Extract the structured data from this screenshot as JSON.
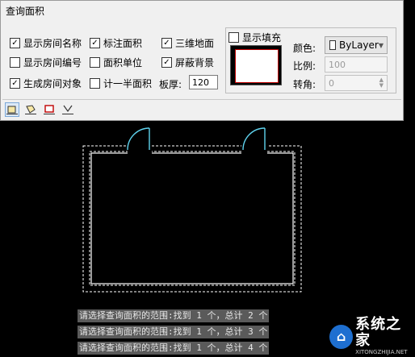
{
  "dialog": {
    "title": "查询面积",
    "options": [
      {
        "label": "显示房间名称",
        "checked": true
      },
      {
        "label": "标注面积",
        "checked": true
      },
      {
        "label": "三维地面",
        "checked": true
      },
      {
        "label": "显示房间编号",
        "checked": false
      },
      {
        "label": "面积单位",
        "checked": false
      },
      {
        "label": "屏蔽背景",
        "checked": true
      },
      {
        "label": "生成房间对象",
        "checked": true
      },
      {
        "label": "计一半面积",
        "checked": false
      }
    ],
    "thickness_label": "板厚:",
    "thickness_value": "120",
    "fill": {
      "show_fill_label": "显示填充",
      "show_fill_checked": false,
      "color_label": "颜色:",
      "color_value": "ByLayer",
      "scale_label": "比例:",
      "scale_value": "100",
      "angle_label": "转角:",
      "angle_value": "0"
    },
    "toolbar_icons": [
      "query-room-icon",
      "query-polygon-icon",
      "query-balcony-icon",
      "query-area-icon"
    ]
  },
  "command_lines": [
    "请选择查询面积的范围:找到 1 个，总计 2 个",
    "请选择查询面积的范围:找到 1 个，总计 3 个",
    "请选择查询面积的范围:找到 1 个，总计 4 个"
  ],
  "watermark": {
    "name": "系统之家",
    "url": "XITONGZHIJIA.NET"
  },
  "colors": {
    "canvas": "#000000",
    "door": "#5fd3ee",
    "wall_line": "#ffffff",
    "fill_border": "#c00000"
  }
}
